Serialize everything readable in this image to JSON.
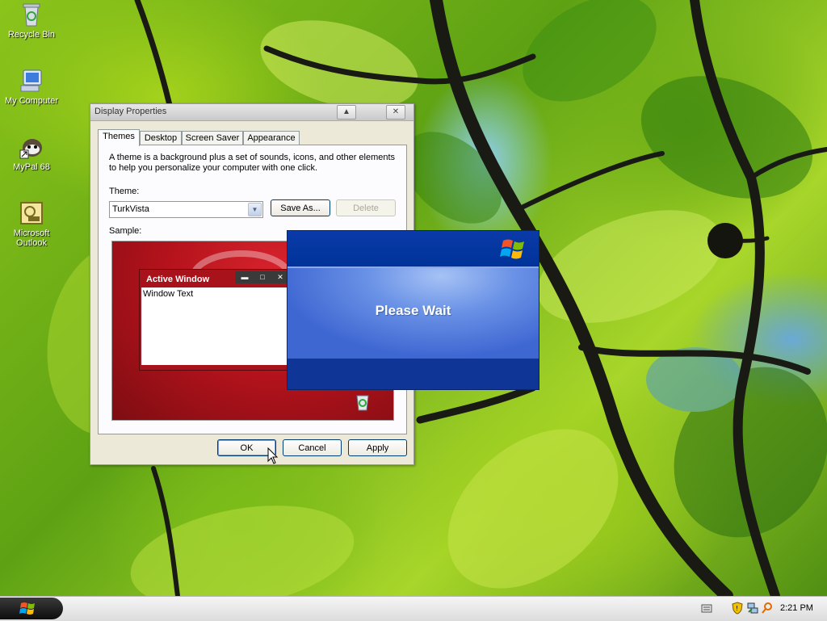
{
  "desktop_icons": [
    {
      "label": "Recycle Bin",
      "icon": "recycle-bin-icon"
    },
    {
      "label": "My Computer",
      "icon": "my-computer-icon"
    },
    {
      "label": "MyPal 68",
      "icon": "mypal-icon"
    },
    {
      "label": "Microsoft Outlook",
      "icon": "outlook-icon"
    }
  ],
  "window": {
    "title": "Display Properties",
    "tabs": [
      "Themes",
      "Desktop",
      "Screen Saver",
      "Appearance"
    ],
    "active_tab": "Themes",
    "description": "A theme is a background plus a set of sounds, icons, and other elements to help you personalize your computer with one click.",
    "theme_label": "Theme:",
    "theme_value": "TurkVista",
    "save_as": "Save As...",
    "delete": "Delete",
    "sample_label": "Sample:",
    "sample": {
      "active_window_title": "Active Window",
      "window_text": "Window Text"
    },
    "ok": "OK",
    "cancel": "Cancel",
    "apply": "Apply"
  },
  "please_wait": {
    "message": "Please Wait"
  },
  "taskbar": {
    "clock": "2:21 PM"
  },
  "colors": {
    "please_wait_blue": "#003399",
    "sample_red": "#b3121b"
  }
}
